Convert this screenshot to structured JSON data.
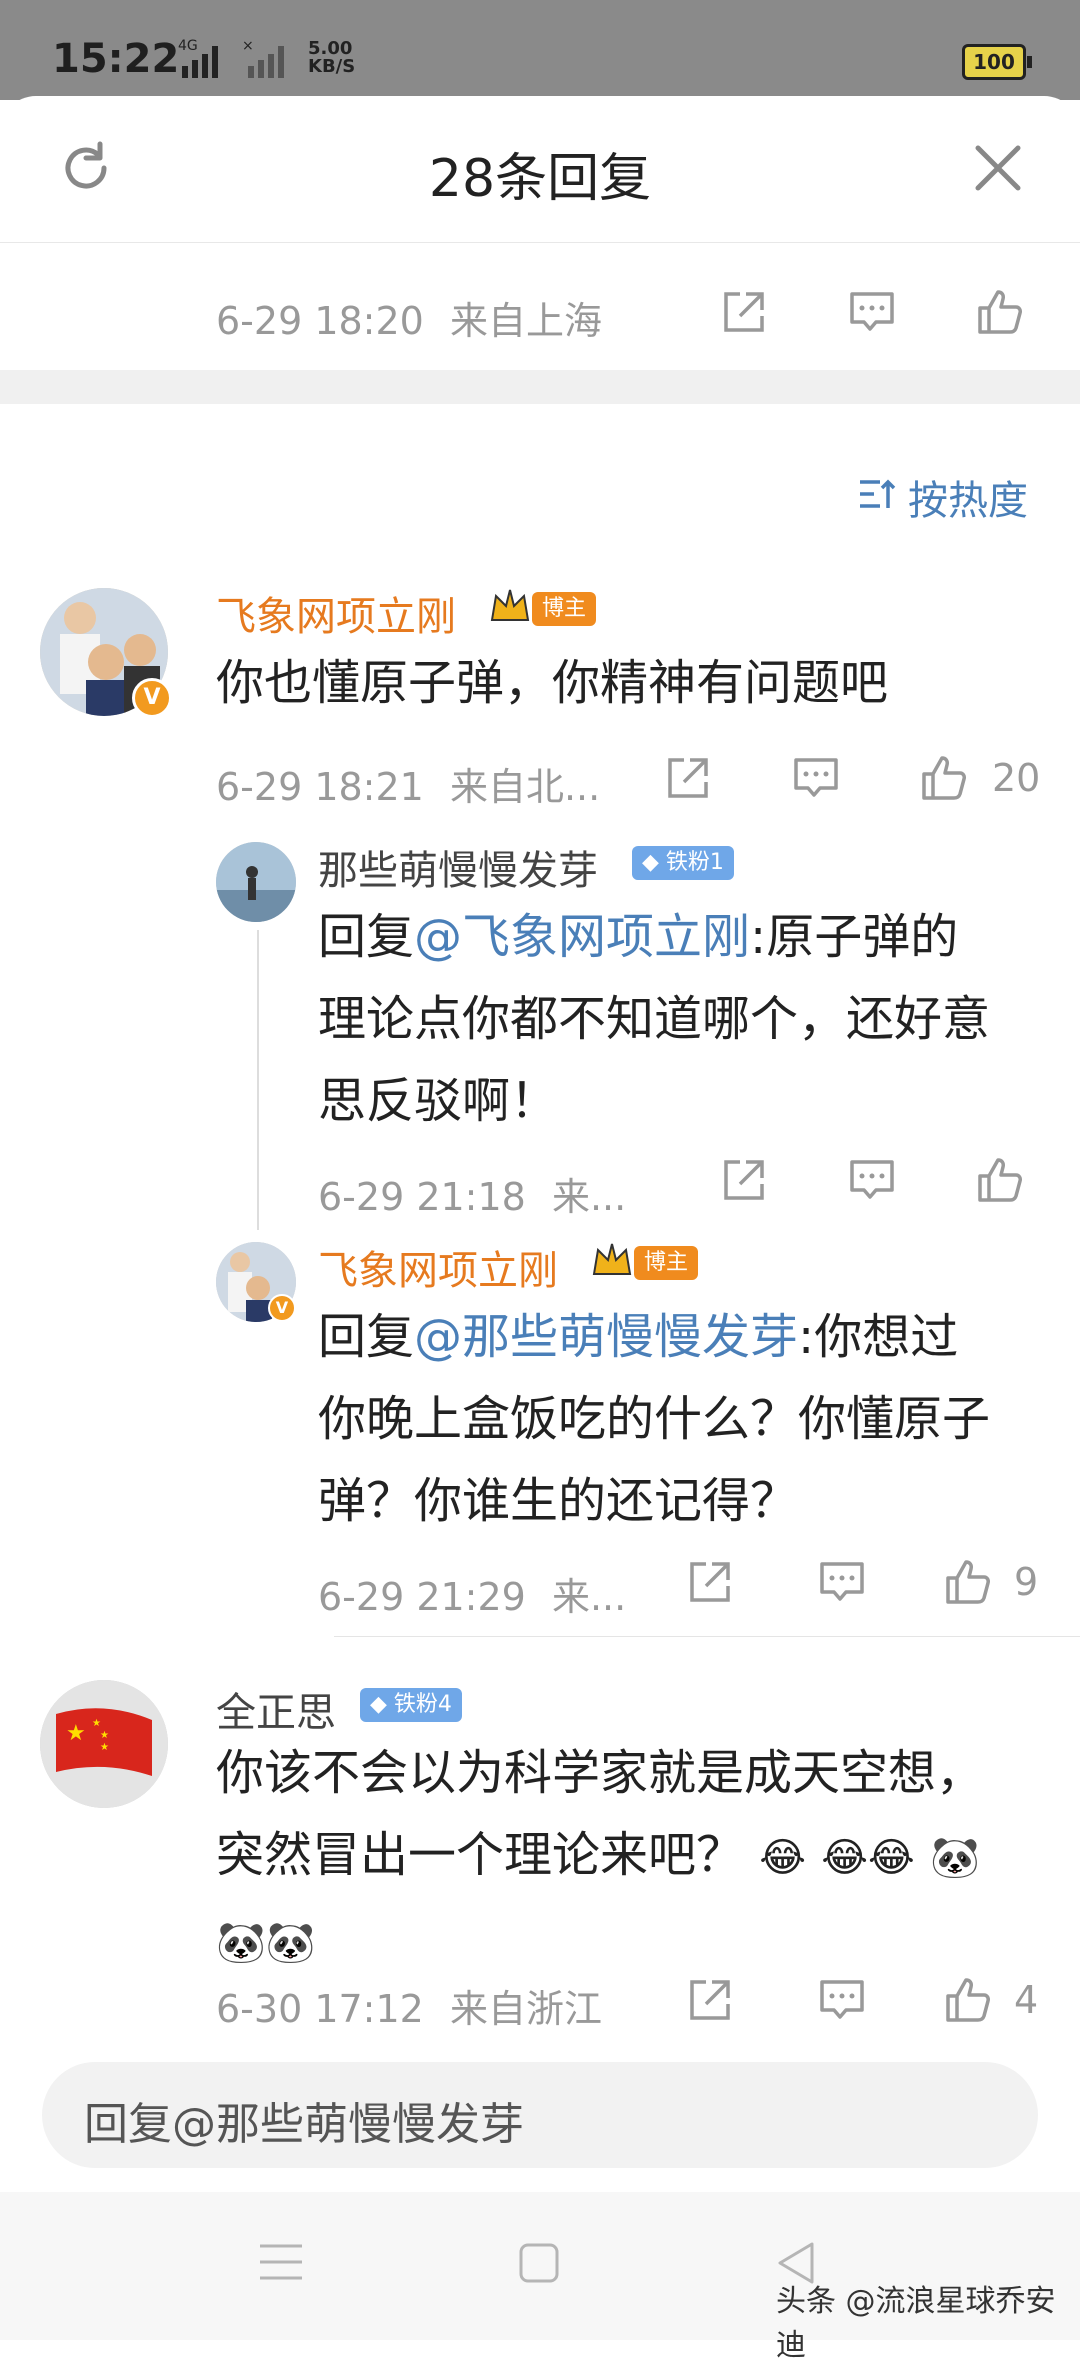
{
  "status_bar": {
    "time": "15:22",
    "network": "4G",
    "speed_value": "5.00",
    "speed_unit": "KB/S",
    "battery": "100"
  },
  "header": {
    "title": "28条回复",
    "refresh_icon": "refresh-icon",
    "close_icon": "close-icon"
  },
  "root_post": {
    "time": "6-29 18:20",
    "location": "来自上海"
  },
  "sort": {
    "label": "按热度"
  },
  "comments": [
    {
      "name": "飞象网项立刚",
      "badge": "博主",
      "text": "你也懂原子弹，你精神有问题吧",
      "time": "6-29 18:21",
      "location": "来自北...",
      "likes": "20",
      "replies": [
        {
          "name": "那些萌慢慢发芽",
          "badge": "铁粉1",
          "reply_prefix": "回复",
          "mention": "@飞象网项立刚",
          "lines": [
            ":原子弹的",
            "理论点你都不知道哪个，还好意",
            "思反驳啊！"
          ],
          "time": "6-29 21:18",
          "location": "来..."
        },
        {
          "name": "飞象网项立刚",
          "badge": "博主",
          "reply_prefix": "回复",
          "mention": "@那些萌慢慢发芽",
          "lines": [
            ":你想过",
            "你晚上盒饭吃的什么？你懂原子",
            "弹？你谁生的还记得？"
          ],
          "time": "6-29 21:29",
          "location": "来...",
          "likes": "9"
        }
      ]
    },
    {
      "name": "全正思",
      "badge": "铁粉4",
      "lines": [
        "你该不会以为科学家就是成天空想，",
        "突然冒出一个理论来吧？"
      ],
      "time": "6-30 17:12",
      "location": "来自浙江",
      "likes": "4"
    }
  ],
  "reply_input": {
    "placeholder": "回复@那些萌慢慢发芽"
  },
  "watermark": "头条 @流浪星球乔安迪"
}
